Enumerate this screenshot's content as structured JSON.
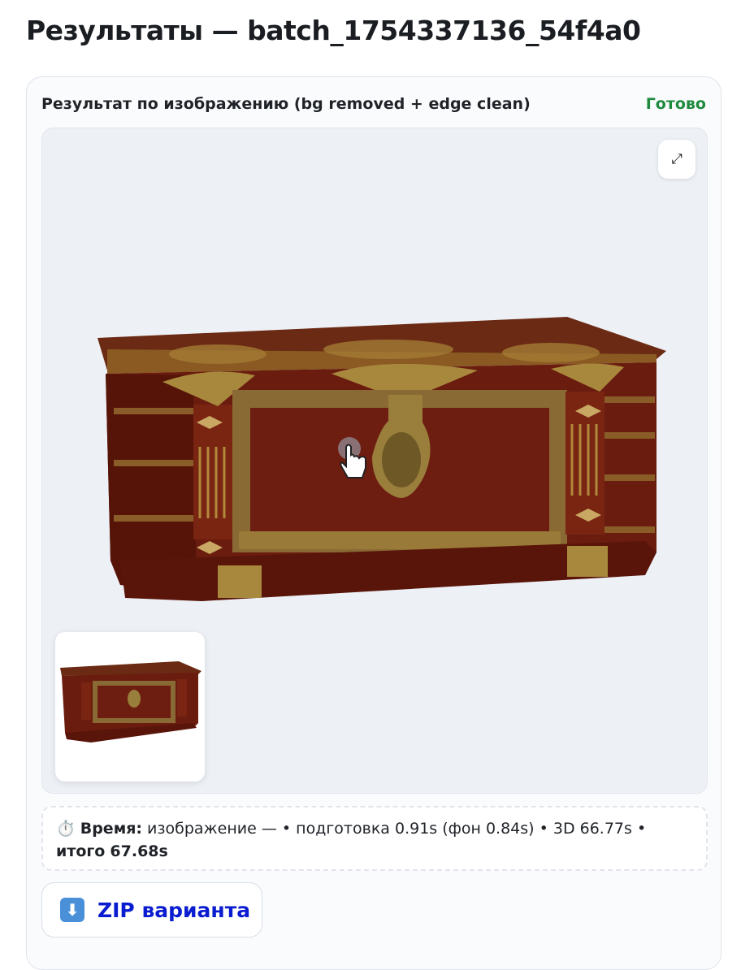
{
  "page": {
    "title": "Результаты — batch_1754337136_54f4a0"
  },
  "card": {
    "title": "Результат по изображению (bg removed + edge clean)",
    "status": "Готово",
    "status_color": "#1e8a3e"
  },
  "viewer": {
    "expand_icon": "⤢",
    "model": "chest-3d-model",
    "thumbnail": "chest-thumbnail"
  },
  "timing": {
    "icon": "⏱️",
    "label": "Время:",
    "image_text": " изображение — • подготовка 0.91s (фон 0.84s) • 3D 66.77s • ",
    "total_label": "итого",
    "total_value": "67.68s"
  },
  "zip_button": {
    "icon": "⬇",
    "label": "ZIP варианта"
  }
}
